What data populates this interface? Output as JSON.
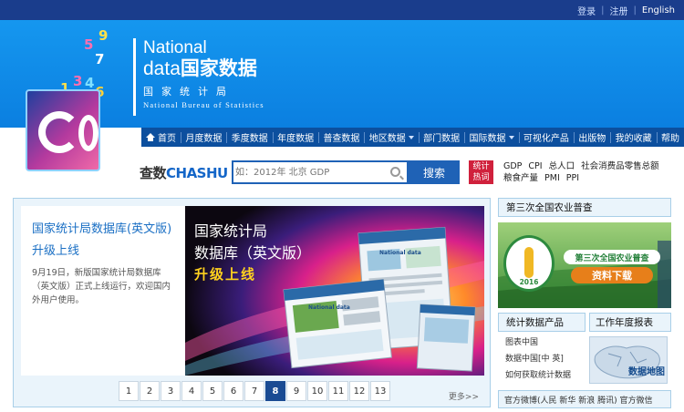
{
  "topbar": {
    "login": "登录",
    "separator": "|",
    "register": "注册",
    "english": "English"
  },
  "brand": {
    "line1": "National",
    "line2_en": "data",
    "line2_cn": "国家数据",
    "cn_name": "国家统计局",
    "en_name": "National Bureau of Statistics"
  },
  "cube_numbers": [
    "1",
    "3",
    "4",
    "2",
    "6",
    "7",
    "9",
    "5"
  ],
  "nav": {
    "items": [
      {
        "label": "首页",
        "icon": "home-icon"
      },
      {
        "label": "月度数据"
      },
      {
        "label": "季度数据"
      },
      {
        "label": "年度数据"
      },
      {
        "label": "普查数据"
      },
      {
        "label": "地区数据",
        "dropdown": true
      },
      {
        "label": "部门数据"
      },
      {
        "label": "国际数据",
        "dropdown": true
      },
      {
        "label": "可视化产品"
      },
      {
        "label": "出版物"
      },
      {
        "label": "我的收藏"
      },
      {
        "label": "帮助"
      }
    ]
  },
  "search": {
    "logo_cn": "查数",
    "logo_en": "CHASHU",
    "placeholder": "如：2012年 北京 GDP",
    "button": "搜索",
    "hot_label_1": "统计",
    "hot_label_2": "热词",
    "hot_row1": [
      "GDP",
      "CPI",
      "总人口",
      "社会消费品零售总额"
    ],
    "hot_row2": [
      "粮食产量",
      "PMI",
      "PPI"
    ]
  },
  "news": {
    "title": "国家统计局数据库(英文版)升级上线",
    "body": "9月19日，新版国家统计局数据库（英文版）正式上线运行，欢迎国内外用户使用。",
    "slide_line1": "国家统计局",
    "slide_line2": "数据库（英文版）",
    "slide_line3": "升级上线",
    "slide_screen1": "National data",
    "slide_screen2": "National data",
    "more": "更多>>"
  },
  "pager": {
    "pages": [
      "1",
      "2",
      "3",
      "4",
      "5",
      "6",
      "7",
      "8",
      "9",
      "10",
      "11",
      "12",
      "13"
    ],
    "active": "8"
  },
  "sidebar": {
    "census_title": "第三次全国农业普查",
    "census_ad_line1": "第三次全国农业普查",
    "census_ad_line2": "资料下载",
    "census_year": "2016",
    "products_title": "统计数据产品",
    "products": [
      "图表中国",
      "数据中国[中 英]",
      "如何获取统计数据"
    ],
    "report_title": "工作年度报表",
    "map_label": "数据地图",
    "social": "官方微博(人民 新华 新浪 腾讯) 官方微信"
  },
  "colors": {
    "topbar": "#1a3d8c",
    "banner": "#1597ef",
    "nav": "#0c4f9e",
    "search_button": "#1f62b6",
    "hot_badge": "#d0213c",
    "link": "#1a6fc4",
    "active_page": "#1a4b93"
  }
}
